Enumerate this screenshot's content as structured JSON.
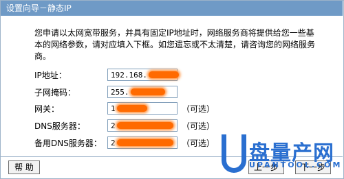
{
  "title": "设置向导－静态IP",
  "description": "您申请以太网宽带服务，并具有固定IP地址时，网络服务商将提供给您一些基本的网络参数，请对应填入下框。如您遗忘或不太清楚，请咨询您的网络服务商。",
  "fields": [
    {
      "label": "IP地址：",
      "value": "192.168.",
      "optional": ""
    },
    {
      "label": "子网掩码：",
      "value": "255.",
      "optional": ""
    },
    {
      "label": "网关：",
      "value": "1",
      "optional": "（可选）"
    },
    {
      "label": "DNS服务器：",
      "value": "2",
      "optional": "（可选）"
    },
    {
      "label": "备用DNS服务器：",
      "value": "2",
      "optional": "（可选）"
    }
  ],
  "buttons": {
    "help": "帮 助",
    "prev": "上一步",
    "next": "下一步"
  },
  "watermark": {
    "text": "盘量产网",
    "sub": "UPANTOOL.COM"
  },
  "colors": {
    "titlebar": "#6f9ac6",
    "redaction": "#ff6a00",
    "watermark": "#2a6fd0"
  }
}
